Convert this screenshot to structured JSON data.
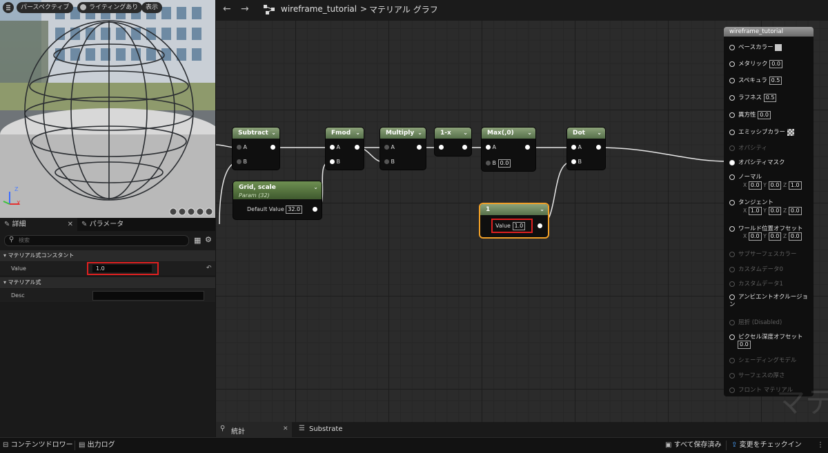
{
  "viewport": {
    "buttons": [
      "パースペクティブ",
      "ライティングあり",
      "表示"
    ],
    "axis_labels": {
      "z": "Z",
      "y": "Y",
      "x": "X"
    }
  },
  "toolbar": {
    "breadcrumb_asset": "wireframe_tutorial",
    "breadcrumb_sep": ">",
    "breadcrumb_graph": "マテリアル グラフ"
  },
  "details": {
    "tab_details": "詳細",
    "tab_params": "パラメータ",
    "search_placeholder": "検索",
    "section_constant": "マテリアル式コンスタント",
    "value_label": "Value",
    "value": "1.0",
    "section_expression": "マテリアル式",
    "desc_label": "Desc",
    "desc_value": ""
  },
  "nodes": {
    "subtract": {
      "title": "Subtract",
      "pins": [
        "A",
        "B"
      ]
    },
    "fmod": {
      "title": "Fmod",
      "pins": [
        "A",
        "B"
      ]
    },
    "multiply": {
      "title": "Multiply",
      "pins": [
        "A",
        "B"
      ]
    },
    "oneminus": {
      "title": "1-x"
    },
    "max": {
      "title": "Max(,0)",
      "pins": [
        "A",
        "B"
      ],
      "b_value": "0.0"
    },
    "dot": {
      "title": "Dot",
      "pins": [
        "A",
        "B"
      ]
    },
    "grid": {
      "title": "Grid, scale",
      "subtitle": "Param (32)",
      "pin_label": "Default Value",
      "pin_value": "32.0"
    },
    "const": {
      "title": "1",
      "pin_label": "Value",
      "pin_value": "1.0"
    }
  },
  "result": {
    "title": "wireframe_tutorial",
    "rows": [
      {
        "label": "ベースカラー",
        "active": true
      },
      {
        "label": "メタリック",
        "value": "0.0",
        "active": true
      },
      {
        "label": "スペキュラ",
        "value": "0.5",
        "active": true
      },
      {
        "label": "ラフネス",
        "value": "0.5",
        "active": true
      },
      {
        "label": "異方性",
        "value": "0.0",
        "active": true
      },
      {
        "label": "エミッシブカラー",
        "active": true
      },
      {
        "label": "オパシティ",
        "active": false
      },
      {
        "label": "オパシティマスク",
        "active": true
      },
      {
        "label": "ノーマル",
        "active": true
      },
      {
        "label": "タンジェント",
        "active": true
      },
      {
        "label": "ワールド位置オフセット",
        "active": true
      },
      {
        "label": "サブサーフェスカラー",
        "active": false
      },
      {
        "label": "カスタムデータ0",
        "active": false
      },
      {
        "label": "カスタムデータ1",
        "active": false
      },
      {
        "label": "アンビエントオクルージョン",
        "active": true
      },
      {
        "label": "屈折 (Disabled)",
        "active": false
      },
      {
        "label": "ピクセル深度オフセット",
        "value": "0.0",
        "active": true
      },
      {
        "label": "シェーディングモデル",
        "active": false
      },
      {
        "label": "サーフェスの厚さ",
        "active": false
      },
      {
        "label": "フロント マテリアル",
        "active": false
      }
    ],
    "normal_xyz": [
      "X",
      "0.0",
      "Y",
      "0.0",
      "Z",
      "1.0"
    ],
    "tangent_xyz": [
      "X",
      "1.0",
      "Y",
      "0.0",
      "Z",
      "0.0"
    ],
    "wpo_xyz": [
      "X",
      "0.0",
      "Y",
      "0.0",
      "Z",
      "0.0"
    ]
  },
  "watermark": "マテ",
  "bottom_tabs": {
    "stats": "統計",
    "substrate": "Substrate"
  },
  "status_bar": {
    "content_drawer": "コンテンツドロワー",
    "output_log": "出力ログ",
    "save_all": "すべて保存済み",
    "check_in": "変更をチェックイン"
  }
}
